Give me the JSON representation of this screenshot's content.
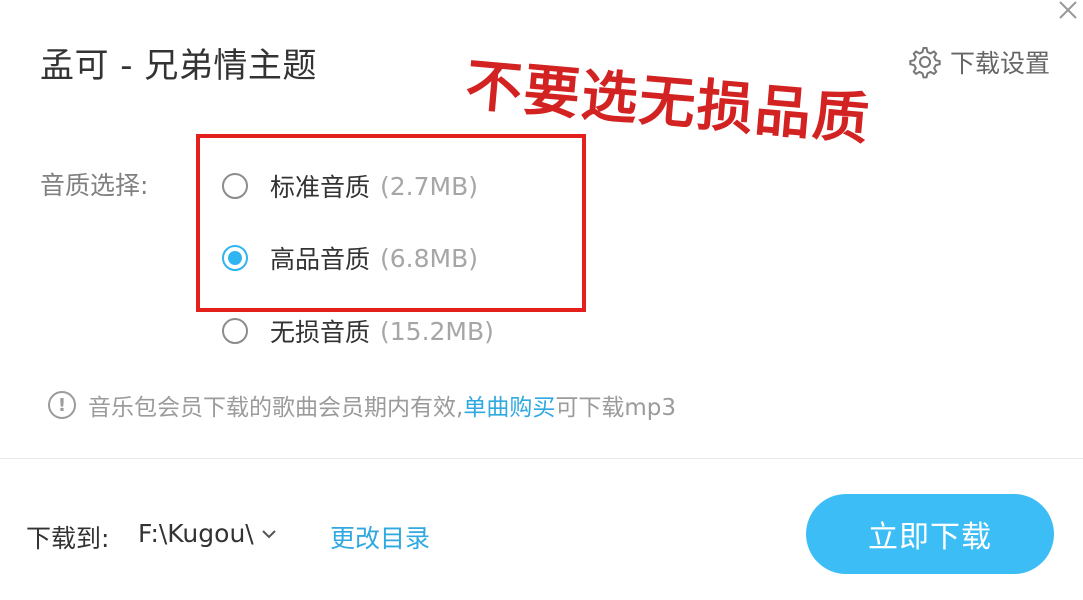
{
  "dialog": {
    "title": "孟可 - 兄弟情主题",
    "settings_label": "下载设置"
  },
  "annotation": {
    "text": "不要选无损品质",
    "color": "#d32222"
  },
  "quality": {
    "label": "音质选择:",
    "options": [
      {
        "name": "标准音质",
        "size": "(2.7MB)",
        "selected": false
      },
      {
        "name": "高品音质",
        "size": "(6.8MB)",
        "selected": true
      },
      {
        "name": "无损音质",
        "size": "(15.2MB)",
        "selected": false
      }
    ]
  },
  "notice": {
    "text_before": "音乐包会员下载的歌曲会员期内有效,",
    "link": "单曲购买",
    "text_after": "可下载mp3"
  },
  "footer": {
    "download_to_label": "下载到:",
    "path": "F:\\Kugou\\",
    "change_dir_label": "更改目录",
    "download_button": "立即下载"
  },
  "colors": {
    "accent": "#3dbdf6",
    "link": "#30a8e0",
    "highlight_box": "#e3201c"
  }
}
